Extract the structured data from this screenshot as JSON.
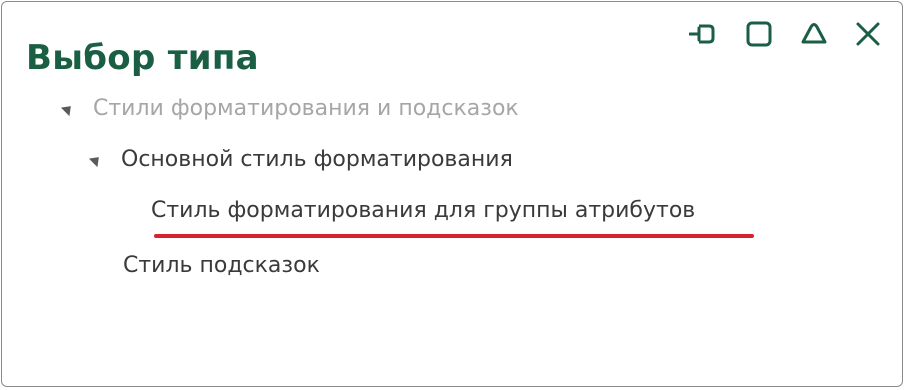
{
  "dialog": {
    "title": "Выбор типа"
  },
  "window_controls": {
    "pin_icon": "pin-icon",
    "maximize_icon": "maximize-icon",
    "collapse_icon": "collapse-icon",
    "close_icon": "close-icon",
    "accent_color": "#1a5e44"
  },
  "tree": {
    "items": [
      {
        "label": "Стили форматирования и подсказок",
        "expanded": true,
        "muted": true
      },
      {
        "label": "Основной стиль форматирования",
        "expanded": true,
        "muted": false
      },
      {
        "label": "Стиль форматирования для группы атрибутов",
        "expanded": false,
        "muted": false,
        "highlighted": true
      },
      {
        "label": "Стиль подсказок",
        "expanded": false,
        "muted": false
      }
    ],
    "highlight_color": "#d8232f"
  }
}
